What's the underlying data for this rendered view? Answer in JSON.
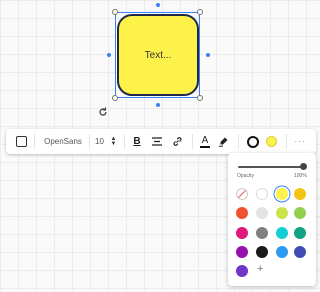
{
  "sticky_note": {
    "text": "Text...",
    "fill": "#fdf24a",
    "border": "#1f2a4b"
  },
  "toolbar": {
    "font_family": "OpenSans",
    "font_size": "10",
    "bold_label": "B",
    "text_color_label": "A",
    "icons": [
      "shape-icon",
      "chevron-up-icon",
      "chevron-down-icon",
      "bold-icon",
      "align-center-icon",
      "link-icon",
      "text-color-icon",
      "highlighter-icon",
      "border-icon",
      "fill-color-icon",
      "more-icon"
    ]
  },
  "color_picker": {
    "opacity_label": "Opacity",
    "opacity_value": "100%",
    "opacity": 1.0,
    "add_label": "+",
    "swatches": [
      [
        "transparent",
        "#ffffff",
        "#fdf24a",
        "#f5c314"
      ],
      [
        "#f0522d",
        "#e3e3e3",
        "#cde34b",
        "#8fd14f"
      ],
      [
        "#e0197a",
        "#808080",
        "#12cdd4",
        "#12a384"
      ],
      [
        "#9510ac",
        "#1a1a1a",
        "#2d9bf0",
        "#414bb2"
      ],
      [
        "#6f37c5"
      ]
    ],
    "selected": "#fdf24a"
  }
}
